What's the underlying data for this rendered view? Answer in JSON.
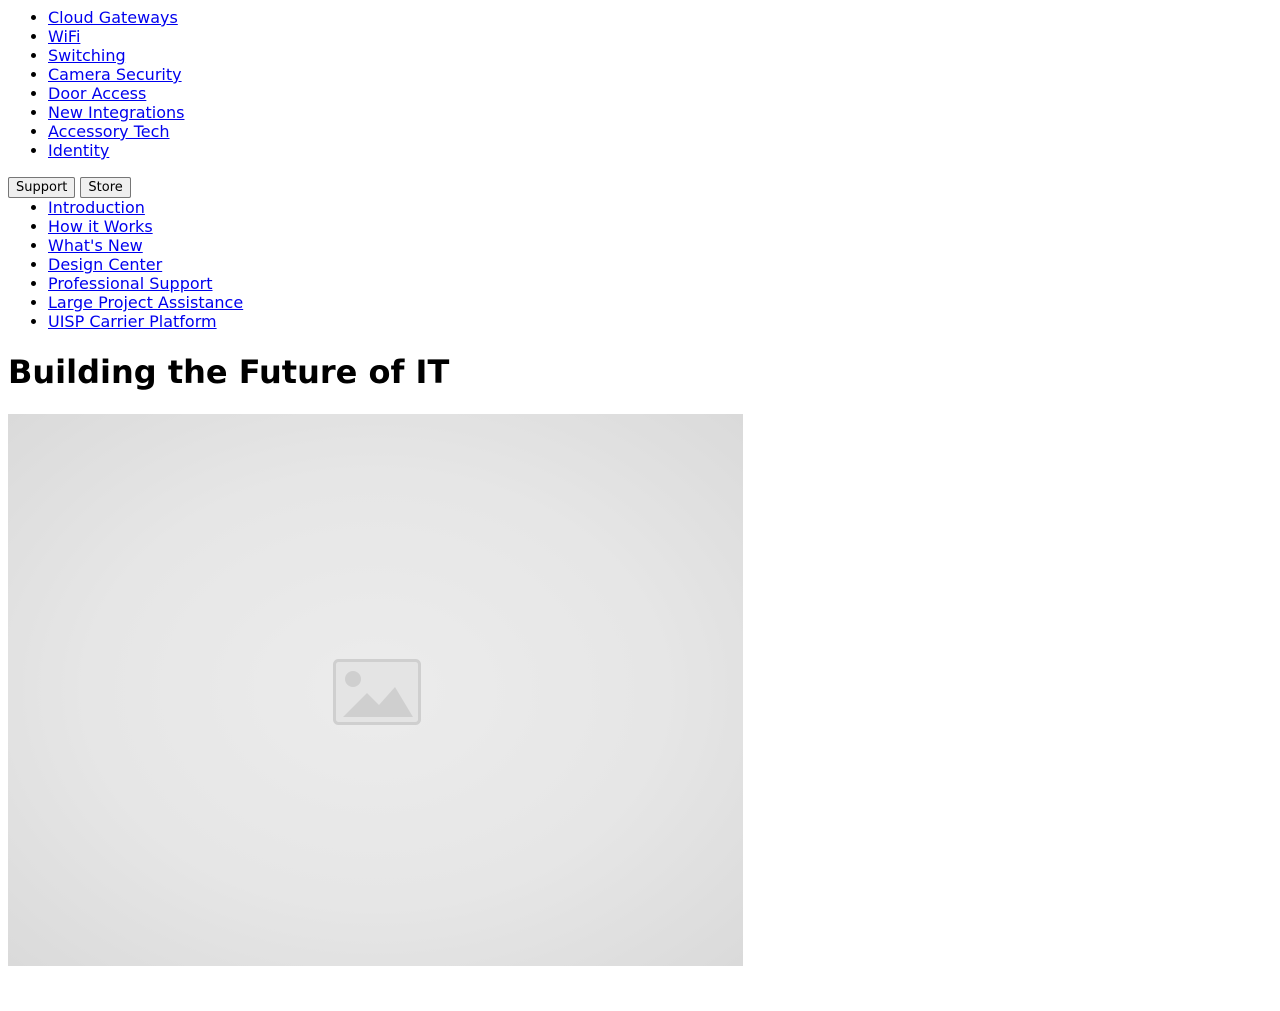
{
  "product_nav": {
    "items": [
      {
        "label": "Cloud Gateways"
      },
      {
        "label": "WiFi"
      },
      {
        "label": "Switching"
      },
      {
        "label": "Camera Security"
      },
      {
        "label": "Door Access"
      },
      {
        "label": "New Integrations"
      },
      {
        "label": "Accessory Tech"
      },
      {
        "label": "Identity"
      }
    ]
  },
  "buttons": {
    "support_label": "Support",
    "store_label": "Store"
  },
  "intro_nav": {
    "items": [
      {
        "label": "Introduction"
      },
      {
        "label": "How it Works"
      },
      {
        "label": "What's New"
      }
    ]
  },
  "pro_nav": {
    "items": [
      {
        "label": "Design Center"
      },
      {
        "label": "Professional Support"
      },
      {
        "label": "Large Project Assistance"
      },
      {
        "label": "UISP Carrier Platform"
      }
    ]
  },
  "main": {
    "heading": "Building the Future of IT",
    "hero_image_icon": "image-placeholder-icon"
  },
  "colors": {
    "link": "#0000ee",
    "hero_background": "#e6e6e6"
  }
}
